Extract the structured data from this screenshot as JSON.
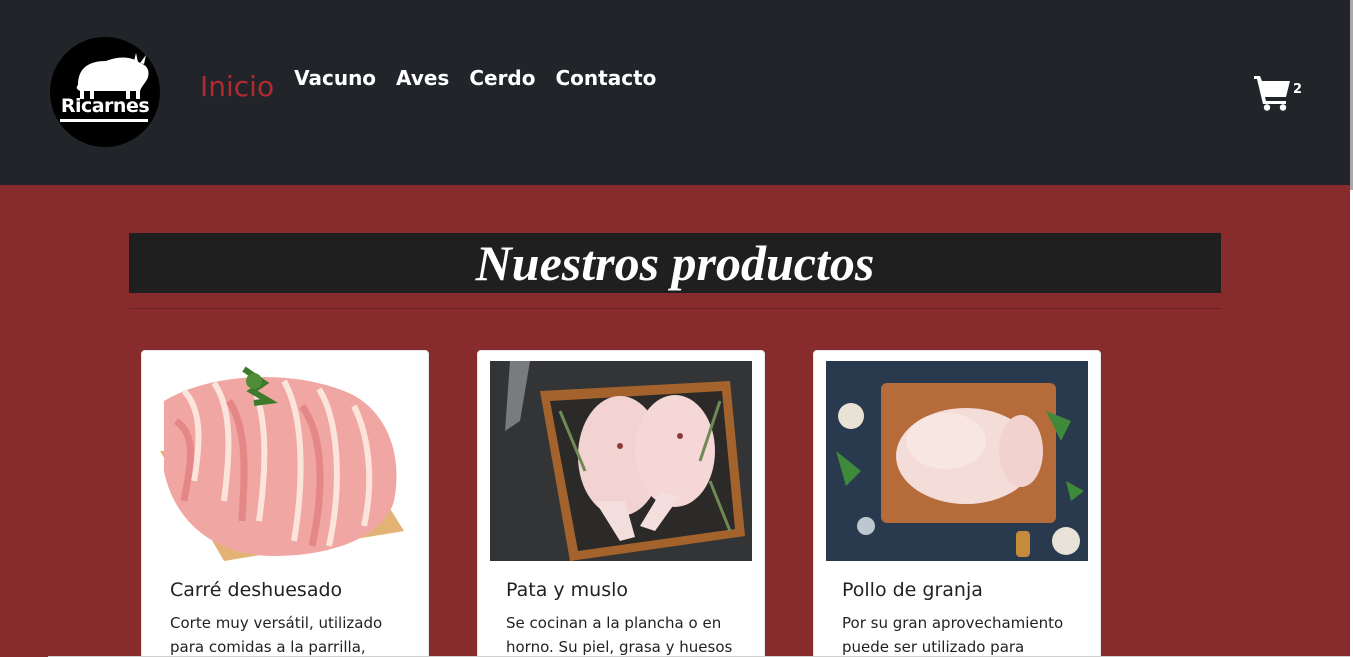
{
  "brand": {
    "name": "Ricarnes",
    "logo_icon": "bull-icon"
  },
  "nav": {
    "items": [
      {
        "label": "Inicio",
        "active": true
      },
      {
        "label": "Vacuno",
        "active": false
      },
      {
        "label": "Aves",
        "active": false
      },
      {
        "label": "Cerdo",
        "active": false
      },
      {
        "label": "Contacto",
        "active": false
      }
    ]
  },
  "cart": {
    "icon": "shopping-cart-icon",
    "count": "2"
  },
  "section": {
    "title": "Nuestros productos"
  },
  "products": [
    {
      "title": "Carré deshuesado",
      "description": "Corte muy versátil, utilizado para comidas a la parrilla, horno",
      "image": "pork-chops-photo"
    },
    {
      "title": "Pata y muslo",
      "description": "Se cocinan a la plancha o en horno. Su piel, grasa y huesos le",
      "image": "chicken-legs-photo"
    },
    {
      "title": "Pollo de granja",
      "description": "Por su gran aprovechamiento puede ser utilizado para",
      "image": "whole-chicken-photo"
    }
  ],
  "colors": {
    "nav_bg": "#212429",
    "page_bg": "#882b2d",
    "accent": "#b02a2f",
    "title_bg": "#1f1f1f"
  }
}
